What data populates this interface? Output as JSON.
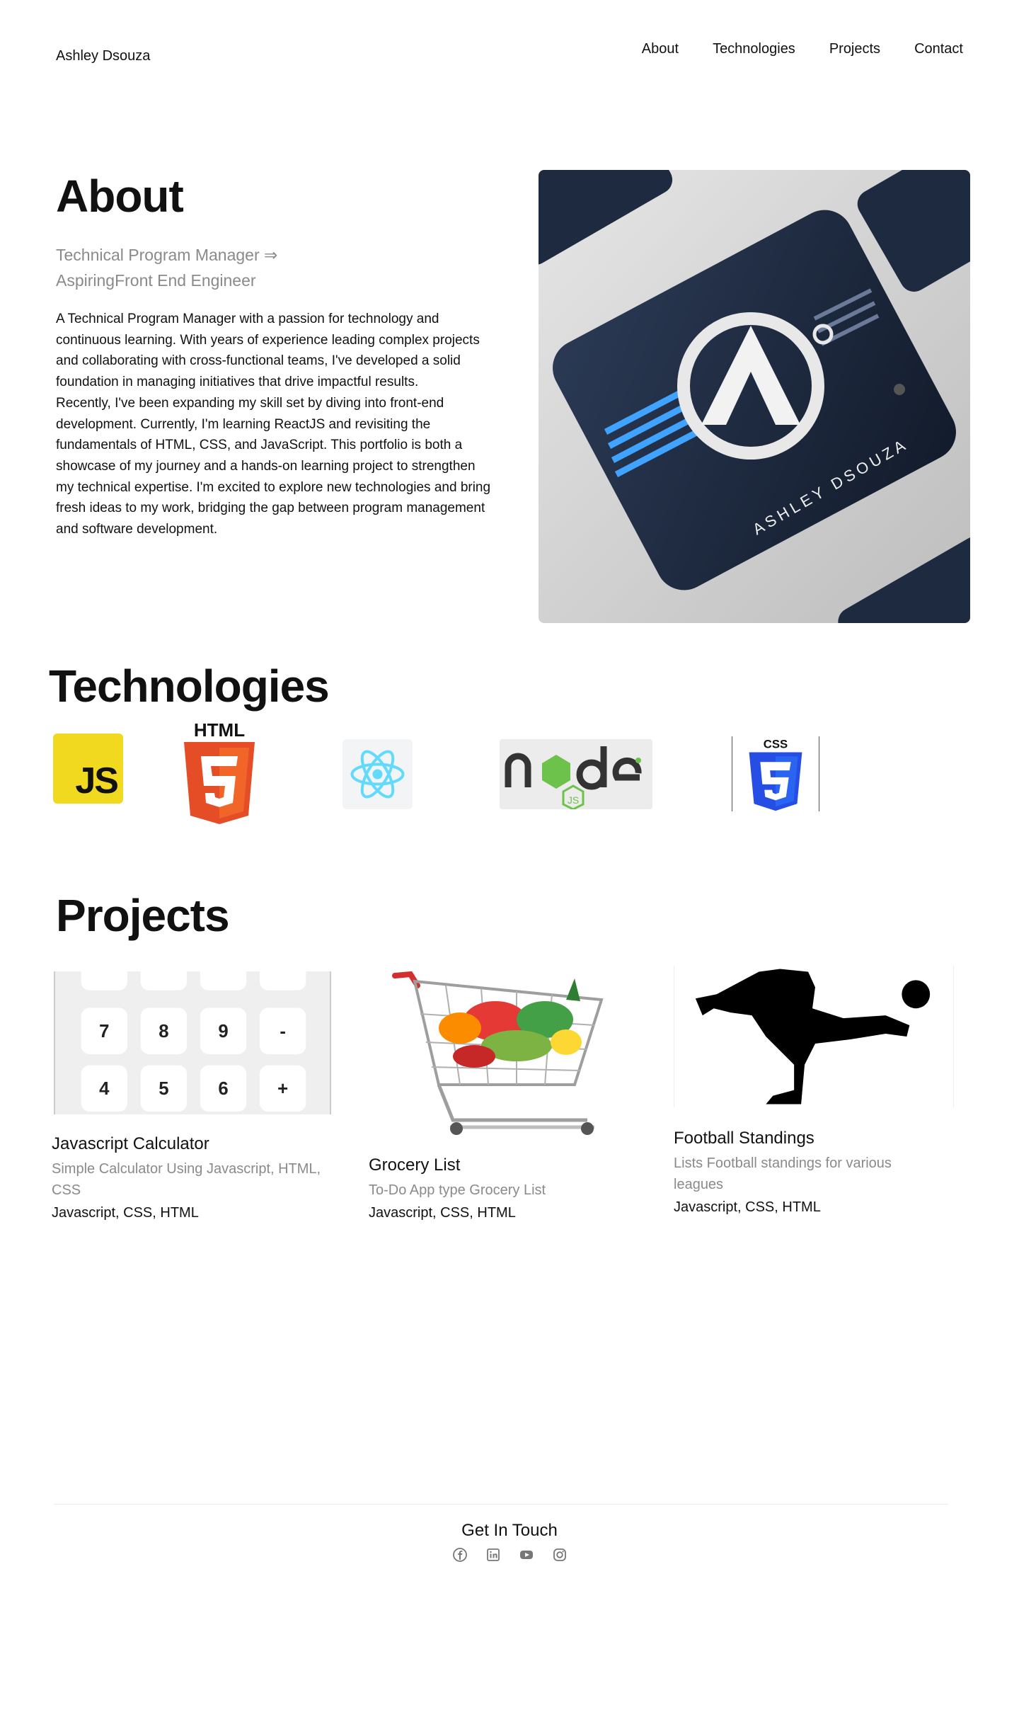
{
  "header": {
    "brand": "Ashley Dsouza",
    "nav": [
      "About",
      "Technologies",
      "Projects",
      "Contact"
    ]
  },
  "about": {
    "title": "About",
    "subtitle_line1": "Technical Program Manager ⇒",
    "subtitle_line2": "AspiringFront End Engineer",
    "paragraph1": "A Technical Program Manager with a passion for technology and continuous learning. With years of experience leading complex projects and collaborating with cross-functional teams, I've developed a solid foundation in managing initiatives that drive impactful results.",
    "paragraph2": "Recently, I've been expanding my skill set by diving into front-end development. Currently, I'm learning ReactJS and revisiting the fundamentals of HTML, CSS, and JavaScript. This portfolio is both a showcase of my journey and a hands-on learning project to strengthen my technical expertise. I'm excited to explore new technologies and bring fresh ideas to my work, bridging the gap between program management and software development.",
    "logo_text": "ASHLEY DSOUZA"
  },
  "technologies": {
    "title": "Technologies",
    "js_label": "JS",
    "html_label": "HTML",
    "css_label": "CSS",
    "icons": [
      "javascript-icon",
      "html5-icon",
      "react-icon",
      "nodejs-icon",
      "css3-icon"
    ]
  },
  "projects": {
    "title": "Projects",
    "items": [
      {
        "name": "Javascript Calculator",
        "description": "Simple Calculator Using Javascript, HTML, CSS",
        "tech": "Javascript, CSS, HTML"
      },
      {
        "name": "Grocery List",
        "description": "To-Do App type Grocery List",
        "tech": "Javascript, CSS, HTML"
      },
      {
        "name": "Football Standings",
        "description": "Lists Football standings for various leagues",
        "tech": "Javascript, CSS, HTML"
      }
    ],
    "calculator_keys": [
      "7",
      "8",
      "9",
      "-",
      "4",
      "5",
      "6",
      "+"
    ]
  },
  "footer": {
    "title": "Get In Touch",
    "socials": [
      "facebook-icon",
      "linkedin-icon",
      "youtube-icon",
      "instagram-icon"
    ]
  },
  "colors": {
    "text": "#111111",
    "muted": "#8a8a8a",
    "js_yellow": "#f0d91e",
    "html_orange": "#e44d26",
    "css_blue": "#1572b6",
    "react_cyan": "#61dafb",
    "node_green": "#6cc24a"
  }
}
